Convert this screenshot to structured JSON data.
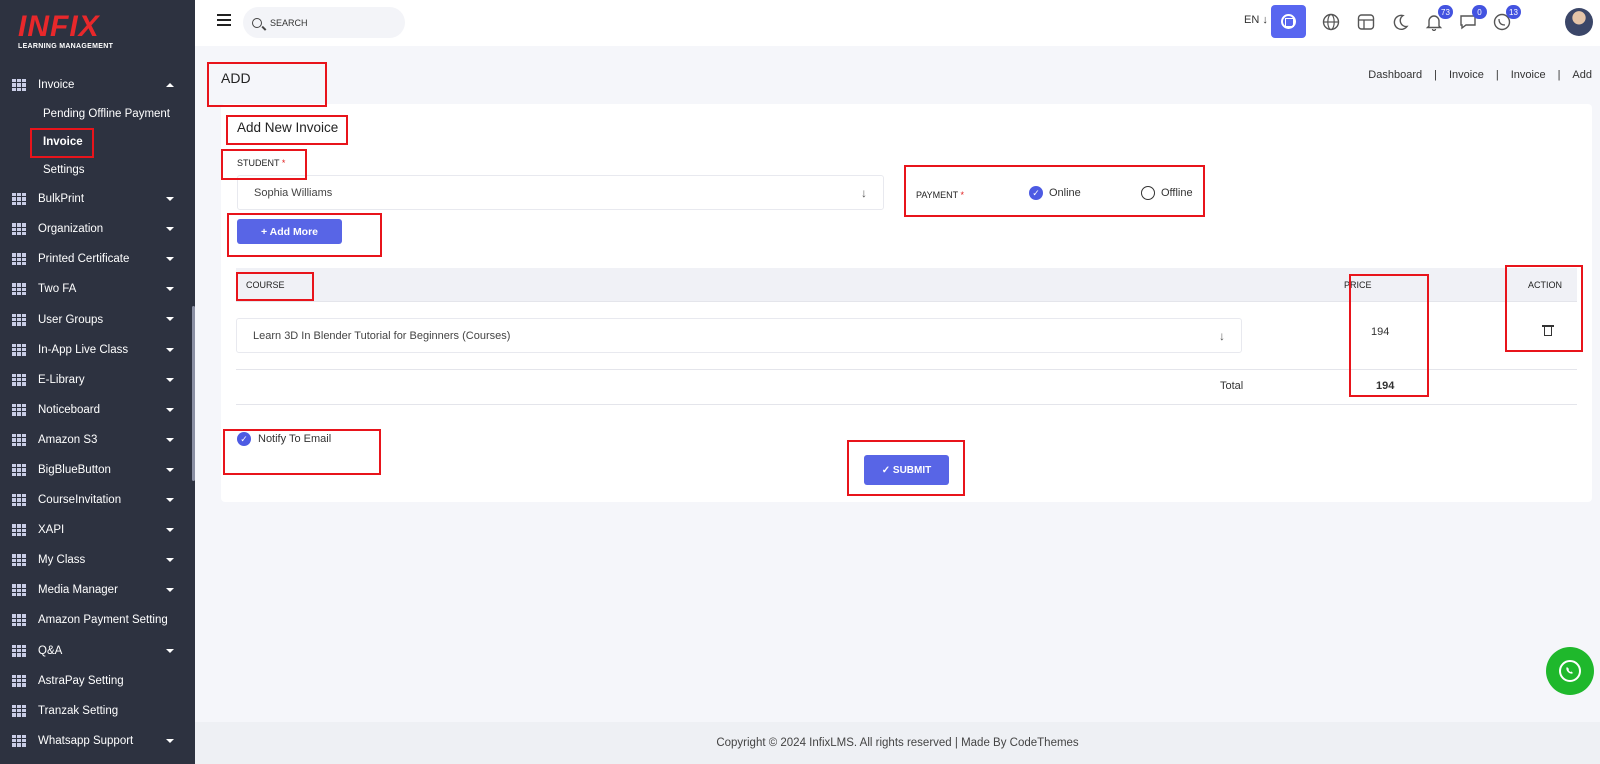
{
  "brand": {
    "logo_text": "INFIX",
    "tagline": "LEARNING MANAGEMENT"
  },
  "sidebar": {
    "open_section": {
      "label": "Invoice",
      "children": [
        {
          "label": "Pending Offline Payment"
        },
        {
          "label": "Invoice"
        },
        {
          "label": "Settings"
        }
      ]
    },
    "items": [
      {
        "label": "BulkPrint"
      },
      {
        "label": "Organization"
      },
      {
        "label": "Printed Certificate"
      },
      {
        "label": "Two FA"
      },
      {
        "label": "User Groups"
      },
      {
        "label": "In-App Live Class"
      },
      {
        "label": "E-Library"
      },
      {
        "label": "Noticeboard"
      },
      {
        "label": "Amazon S3"
      },
      {
        "label": "BigBlueButton"
      },
      {
        "label": "CourseInvitation"
      },
      {
        "label": "XAPI"
      },
      {
        "label": "My Class"
      },
      {
        "label": "Media Manager"
      },
      {
        "label": "Amazon Payment Setting"
      },
      {
        "label": "Q&A"
      },
      {
        "label": "AstraPay Setting"
      },
      {
        "label": "Tranzak Setting"
      },
      {
        "label": "Whatsapp Support"
      }
    ]
  },
  "topbar": {
    "search_placeholder": "SEARCH",
    "language": "EN ↓",
    "notifications_count": "73",
    "messages_count": "0",
    "calls_count": "13"
  },
  "page": {
    "title": "ADD",
    "breadcrumb": [
      "Dashboard",
      "Invoice",
      "Invoice",
      "Add"
    ]
  },
  "form": {
    "card_title": "Add New Invoice",
    "student_label": "STUDENT",
    "required_mark": "*",
    "student_value": "Sophia Williams",
    "payment_label": "PAYMENT",
    "payment_options": [
      "Online",
      "Offline"
    ],
    "payment_selected": "Online",
    "add_more_label": "+ Add More",
    "table_headers": {
      "course": "COURSE",
      "price": "PRICE",
      "action": "ACTION"
    },
    "rows": [
      {
        "course": "Learn 3D In Blender Tutorial for Beginners (Courses)",
        "price": "194"
      }
    ],
    "total_label": "Total",
    "total_value": "194",
    "notify_label": "Notify To Email",
    "submit_label": "✓ SUBMIT"
  },
  "footer": {
    "text": "Copyright © 2024 InfixLMS. All rights reserved | Made By CodeThemes"
  },
  "colors": {
    "accent": "#5865e6",
    "sidebar_bg": "#2d3240",
    "highlight": "#e8141b",
    "whatsapp": "#1fb82c"
  }
}
